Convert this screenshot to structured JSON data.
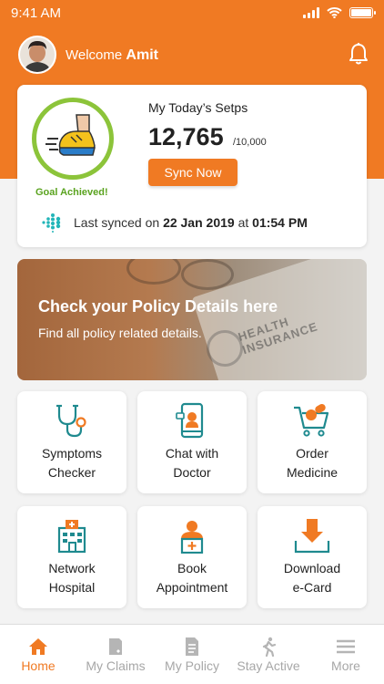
{
  "status_bar": {
    "time": "9:41 AM"
  },
  "header": {
    "welcome_prefix": "Welcome",
    "user_name": "Amit"
  },
  "steps_card": {
    "title": "My Today’s Setps",
    "steps": "12,765",
    "goal": "/10,000",
    "goal_status": "Goal Achieved!",
    "sync_button": "Sync Now",
    "last_synced_prefix": "Last synced on",
    "last_synced_date": "22 Jan 2019",
    "last_synced_at": "at",
    "last_synced_time": "01:54 PM"
  },
  "banner": {
    "title": "Check your Policy Details here",
    "subtitle": "Find all policy related details.",
    "image_text": "HEALTH INSURANCE"
  },
  "tiles": [
    {
      "line1": "Symptoms",
      "line2": "Checker",
      "icon": "stethoscope-icon"
    },
    {
      "line1": "Chat with",
      "line2": "Doctor",
      "icon": "phone-doctor-icon"
    },
    {
      "line1": "Order",
      "line2": "Medicine",
      "icon": "cart-medicine-icon"
    },
    {
      "line1": "Network",
      "line2": "Hospital",
      "icon": "hospital-icon"
    },
    {
      "line1": "Book",
      "line2": "Appointment",
      "icon": "doctor-icon"
    },
    {
      "line1": "Download",
      "line2": "e-Card",
      "icon": "download-icon"
    }
  ],
  "bottom_nav": [
    {
      "label": "Home",
      "icon": "home-icon",
      "active": true
    },
    {
      "label": "My Claims",
      "icon": "claims-icon",
      "active": false
    },
    {
      "label": "My Policy",
      "icon": "policy-icon",
      "active": false
    },
    {
      "label": "Stay Active",
      "icon": "runner-icon",
      "active": false
    },
    {
      "label": "More",
      "icon": "menu-icon",
      "active": false
    }
  ],
  "colors": {
    "brand": "#f07a23",
    "goal_green": "#8cc43a",
    "icon_teal": "#1f8a8f",
    "nav_inactive": "#a7a7a7"
  }
}
